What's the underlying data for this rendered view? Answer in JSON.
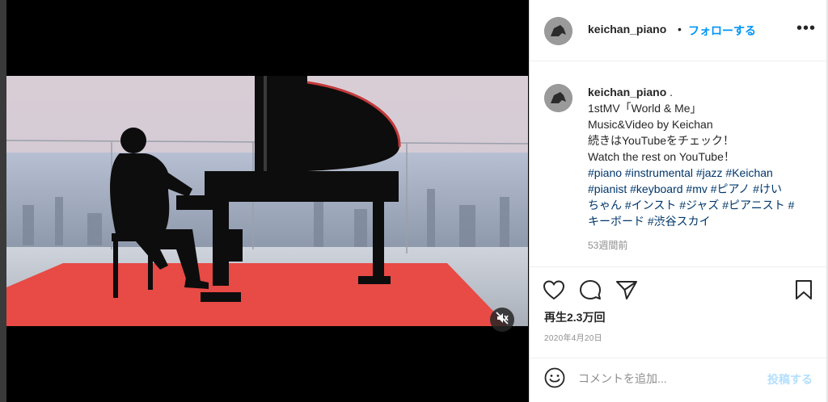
{
  "post": {
    "username": "keichan_piano",
    "separator": "•",
    "follow_label": "フォローする",
    "more_label": "•••"
  },
  "caption": {
    "username": "keichan_piano",
    "username_suffix": " .",
    "lines": [
      "1stMV「World & Me」",
      "Music&Video by Keichan",
      "続きはYouTubeをチェック！",
      "Watch the rest on YouTube！"
    ],
    "hashtag_lines": [
      "#piano #instrumental #jazz #Keichan",
      "#pianist #keyboard #mv #ピアノ #けい",
      "ちゃん #インスト #ジャズ #ピアニスト #",
      "キーボード #渋谷スカイ"
    ],
    "time_ago": "53週間前"
  },
  "actions": {
    "like_icon": "heart-icon",
    "comment_icon": "comment-icon",
    "share_icon": "paper-plane-icon",
    "save_icon": "bookmark-icon",
    "views": "再生2.3万回",
    "date": "2020年4月20日"
  },
  "comment_box": {
    "emoji_icon": "smiley-icon",
    "placeholder": "コメントを追加...",
    "post_label": "投稿する"
  },
  "media": {
    "mute_icon": "speaker-muted-icon"
  },
  "colors": {
    "link_blue": "#0095f6",
    "hashtag": "#00376b",
    "carpet_red": "#e84a45",
    "post_disabled": "#b2dffc"
  }
}
